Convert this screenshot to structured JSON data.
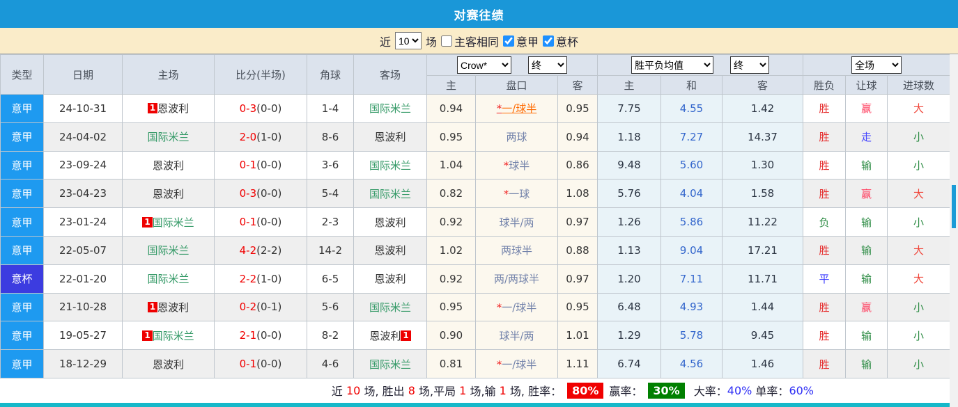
{
  "title": "对赛往绩",
  "colors": {
    "titlebar_blue": "#1a97d8",
    "filterbar_cream": "#faecc9",
    "serie_a_blue": "#1e9af0",
    "coppa_purple": "#3c3ce0",
    "team_green": "#339966",
    "score_red": "#f00000",
    "win_red": "#e62f2f",
    "lose_green": "#2f8d46",
    "draw_blue": "#3a3aff",
    "handicap_win_pink": "#ff4060",
    "handicap_push_blue": "#4646ff",
    "highlight_orange": "#ff6a00",
    "bottom_teal": "#15b8c9"
  },
  "filterbar": {
    "near_label": "近",
    "matches_count": "10",
    "unit_label": "场",
    "checkboxes": [
      {
        "label": "主客相同",
        "checked": false
      },
      {
        "label": "意甲",
        "checked": true
      },
      {
        "label": "意杯",
        "checked": true
      }
    ]
  },
  "table": {
    "static_headers": [
      "类型",
      "日期",
      "主场",
      "比分(半场)",
      "角球",
      "客场"
    ],
    "selects": {
      "odds_company": "Crow*",
      "odds_company_state": "终",
      "avg_label": "胜平负均值",
      "avg_state": "终",
      "scope": "全场"
    },
    "sub_headers": [
      "主",
      "盘口",
      "客",
      "主",
      "和",
      "客",
      "胜负",
      "让球",
      "进球数"
    ],
    "rows": [
      {
        "type": {
          "text": "意甲",
          "color": "#1e9af0"
        },
        "date": "24-10-31",
        "home": {
          "badge_before": "1",
          "name": "恩波利",
          "green": false
        },
        "score": {
          "full": "0-3",
          "half": "(0-0)"
        },
        "corner": "1-4",
        "away": {
          "name": "国际米兰",
          "green": true
        },
        "odds": {
          "home": "0.94",
          "handicap": {
            "star": true,
            "text": "一/球半",
            "highlight": true
          },
          "away": "0.95"
        },
        "avg": {
          "home": "7.75",
          "draw": "4.55",
          "away": "1.42"
        },
        "result": {
          "text": "胜",
          "cls": "red"
        },
        "handicap_result": {
          "text": "赢",
          "cls": "pink"
        },
        "goals": {
          "text": "大",
          "cls": "big"
        }
      },
      {
        "type": {
          "text": "意甲",
          "color": "#1e9af0"
        },
        "date": "24-04-02",
        "home": {
          "name": "国际米兰",
          "green": true
        },
        "score": {
          "full": "2-0",
          "half": "(1-0)"
        },
        "corner": "8-6",
        "away": {
          "name": "恩波利",
          "green": false
        },
        "odds": {
          "home": "0.95",
          "handicap": {
            "star": false,
            "text": "两球",
            "highlight": false
          },
          "away": "0.94"
        },
        "avg": {
          "home": "1.18",
          "draw": "7.27",
          "away": "14.37"
        },
        "result": {
          "text": "胜",
          "cls": "red"
        },
        "handicap_result": {
          "text": "走",
          "cls": "push"
        },
        "goals": {
          "text": "小",
          "cls": "small"
        }
      },
      {
        "type": {
          "text": "意甲",
          "color": "#1e9af0"
        },
        "date": "23-09-24",
        "home": {
          "name": "恩波利",
          "green": false
        },
        "score": {
          "full": "0-1",
          "half": "(0-0)"
        },
        "corner": "3-6",
        "away": {
          "name": "国际米兰",
          "green": true
        },
        "odds": {
          "home": "1.04",
          "handicap": {
            "star": true,
            "text": "球半",
            "highlight": false
          },
          "away": "0.86"
        },
        "avg": {
          "home": "9.48",
          "draw": "5.60",
          "away": "1.30"
        },
        "result": {
          "text": "胜",
          "cls": "red"
        },
        "handicap_result": {
          "text": "输",
          "cls": "green"
        },
        "goals": {
          "text": "小",
          "cls": "small"
        }
      },
      {
        "type": {
          "text": "意甲",
          "color": "#1e9af0"
        },
        "date": "23-04-23",
        "home": {
          "name": "恩波利",
          "green": false
        },
        "score": {
          "full": "0-3",
          "half": "(0-0)"
        },
        "corner": "5-4",
        "away": {
          "name": "国际米兰",
          "green": true
        },
        "odds": {
          "home": "0.82",
          "handicap": {
            "star": true,
            "text": "一球",
            "highlight": false
          },
          "away": "1.08"
        },
        "avg": {
          "home": "5.76",
          "draw": "4.04",
          "away": "1.58"
        },
        "result": {
          "text": "胜",
          "cls": "red"
        },
        "handicap_result": {
          "text": "赢",
          "cls": "pink"
        },
        "goals": {
          "text": "大",
          "cls": "big"
        }
      },
      {
        "type": {
          "text": "意甲",
          "color": "#1e9af0"
        },
        "date": "23-01-24",
        "home": {
          "badge_before": "1",
          "name": "国际米兰",
          "green": true
        },
        "score": {
          "full": "0-1",
          "half": "(0-0)"
        },
        "corner": "2-3",
        "away": {
          "name": "恩波利",
          "green": false
        },
        "odds": {
          "home": "0.92",
          "handicap": {
            "star": false,
            "text": "球半/两",
            "highlight": false
          },
          "away": "0.97"
        },
        "avg": {
          "home": "1.26",
          "draw": "5.86",
          "away": "11.22"
        },
        "result": {
          "text": "负",
          "cls": "green"
        },
        "handicap_result": {
          "text": "输",
          "cls": "green"
        },
        "goals": {
          "text": "小",
          "cls": "small"
        }
      },
      {
        "type": {
          "text": "意甲",
          "color": "#1e9af0"
        },
        "date": "22-05-07",
        "home": {
          "name": "国际米兰",
          "green": true
        },
        "score": {
          "full": "4-2",
          "half": "(2-2)"
        },
        "corner": "14-2",
        "away": {
          "name": "恩波利",
          "green": false
        },
        "odds": {
          "home": "1.02",
          "handicap": {
            "star": false,
            "text": "两球半",
            "highlight": false
          },
          "away": "0.88"
        },
        "avg": {
          "home": "1.13",
          "draw": "9.04",
          "away": "17.21"
        },
        "result": {
          "text": "胜",
          "cls": "red"
        },
        "handicap_result": {
          "text": "输",
          "cls": "green"
        },
        "goals": {
          "text": "大",
          "cls": "big"
        }
      },
      {
        "type": {
          "text": "意杯",
          "color": "#3c3ce0"
        },
        "date": "22-01-20",
        "home": {
          "name": "国际米兰",
          "green": true
        },
        "score": {
          "full": "2-2",
          "half": "(1-0)"
        },
        "corner": "6-5",
        "away": {
          "name": "恩波利",
          "green": false
        },
        "odds": {
          "home": "0.92",
          "handicap": {
            "star": false,
            "text": "两/两球半",
            "highlight": false
          },
          "away": "0.97"
        },
        "avg": {
          "home": "1.20",
          "draw": "7.11",
          "away": "11.71"
        },
        "result": {
          "text": "平",
          "cls": "blue"
        },
        "handicap_result": {
          "text": "输",
          "cls": "green"
        },
        "goals": {
          "text": "大",
          "cls": "big"
        }
      },
      {
        "type": {
          "text": "意甲",
          "color": "#1e9af0"
        },
        "date": "21-10-28",
        "home": {
          "badge_before": "1",
          "name": "恩波利",
          "green": false
        },
        "score": {
          "full": "0-2",
          "half": "(0-1)"
        },
        "corner": "5-6",
        "away": {
          "name": "国际米兰",
          "green": true
        },
        "odds": {
          "home": "0.95",
          "handicap": {
            "star": true,
            "text": "一/球半",
            "highlight": false
          },
          "away": "0.95"
        },
        "avg": {
          "home": "6.48",
          "draw": "4.93",
          "away": "1.44"
        },
        "result": {
          "text": "胜",
          "cls": "red"
        },
        "handicap_result": {
          "text": "赢",
          "cls": "pink"
        },
        "goals": {
          "text": "小",
          "cls": "small"
        }
      },
      {
        "type": {
          "text": "意甲",
          "color": "#1e9af0"
        },
        "date": "19-05-27",
        "home": {
          "badge_before": "1",
          "name": "国际米兰",
          "green": true
        },
        "score": {
          "full": "2-1",
          "half": "(0-0)"
        },
        "corner": "8-2",
        "away": {
          "name": "恩波利",
          "green": false,
          "badge_after": "1"
        },
        "odds": {
          "home": "0.90",
          "handicap": {
            "star": false,
            "text": "球半/两",
            "highlight": false
          },
          "away": "1.01"
        },
        "avg": {
          "home": "1.29",
          "draw": "5.78",
          "away": "9.45"
        },
        "result": {
          "text": "胜",
          "cls": "red"
        },
        "handicap_result": {
          "text": "输",
          "cls": "green"
        },
        "goals": {
          "text": "小",
          "cls": "small"
        }
      },
      {
        "type": {
          "text": "意甲",
          "color": "#1e9af0"
        },
        "date": "18-12-29",
        "home": {
          "name": "恩波利",
          "green": false
        },
        "score": {
          "full": "0-1",
          "half": "(0-0)"
        },
        "corner": "4-6",
        "away": {
          "name": "国际米兰",
          "green": true
        },
        "odds": {
          "home": "0.81",
          "handicap": {
            "star": true,
            "text": "一/球半",
            "highlight": false
          },
          "away": "1.11"
        },
        "avg": {
          "home": "6.74",
          "draw": "4.56",
          "away": "1.46"
        },
        "result": {
          "text": "胜",
          "cls": "red"
        },
        "handicap_result": {
          "text": "输",
          "cls": "green"
        },
        "goals": {
          "text": "小",
          "cls": "small"
        }
      }
    ]
  },
  "summary": {
    "segments": [
      {
        "text": "近 ",
        "style": "plain"
      },
      {
        "text": "10",
        "style": "num"
      },
      {
        "text": " 场, 胜出 ",
        "style": "plain"
      },
      {
        "text": "8",
        "style": "num"
      },
      {
        "text": " 场,平局 ",
        "style": "plain"
      },
      {
        "text": "1",
        "style": "num"
      },
      {
        "text": " 场,输 ",
        "style": "plain"
      },
      {
        "text": "1",
        "style": "num"
      },
      {
        "text": " 场, 胜率：",
        "style": "plain"
      },
      {
        "text": "80%",
        "style": "badge-red"
      },
      {
        "text": "赢率：",
        "style": "plain"
      },
      {
        "text": "30%",
        "style": "badge-green"
      },
      {
        "text": " 大率：",
        "style": "plain"
      },
      {
        "text": "40%",
        "style": "blue"
      },
      {
        "text": " 单率：",
        "style": "plain"
      },
      {
        "text": "60%",
        "style": "blue"
      }
    ]
  }
}
